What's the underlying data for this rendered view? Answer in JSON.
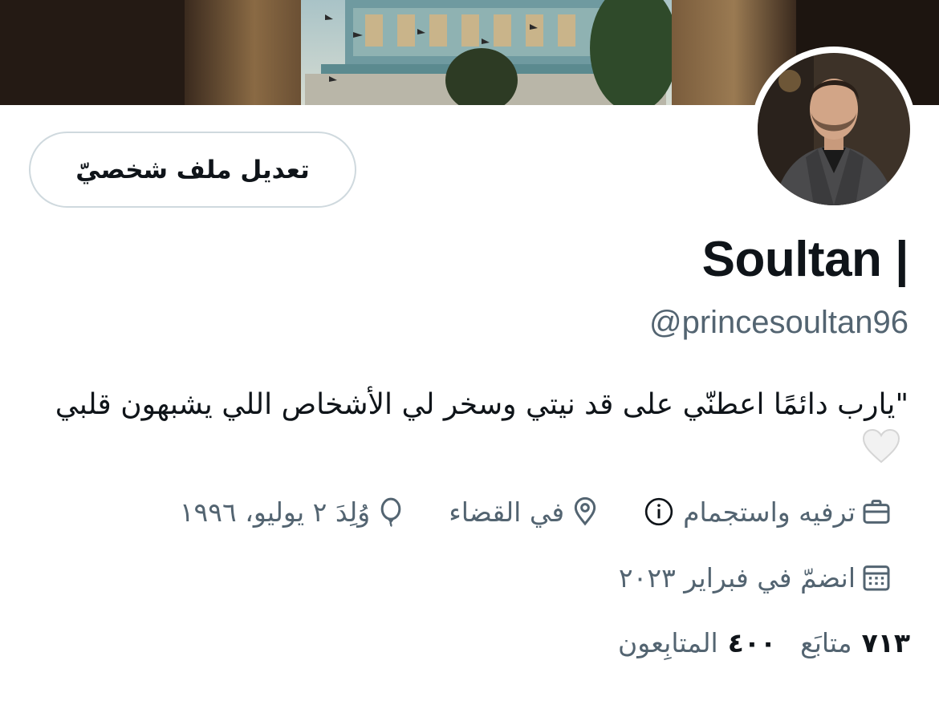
{
  "profile": {
    "name": "Soultan |",
    "handle": "@princesoultan96",
    "bio": "\"يارب دائمًا اعطنّي على قد نيتي وسخر لي الأشخاص اللي يشبهون قلبي",
    "bio_emoji": "white-heart-icon"
  },
  "actions": {
    "edit_profile": "تعديل ملف شخصيّ"
  },
  "meta": {
    "category": "ترفيه واستجمام",
    "location": "في القضاء",
    "birthday": "وُلِدَ ٢ يوليو، ١٩٩٦",
    "joined": "انضمّ في فبراير ٢٠٢٣"
  },
  "stats": {
    "following_count": "٧١٣",
    "following_label": "متابَع",
    "followers_count": "٤٠٠",
    "followers_label": "المتابِعون"
  },
  "colors": {
    "text_primary": "#0f1419",
    "text_secondary": "#536471",
    "border": "#cfd9de"
  }
}
